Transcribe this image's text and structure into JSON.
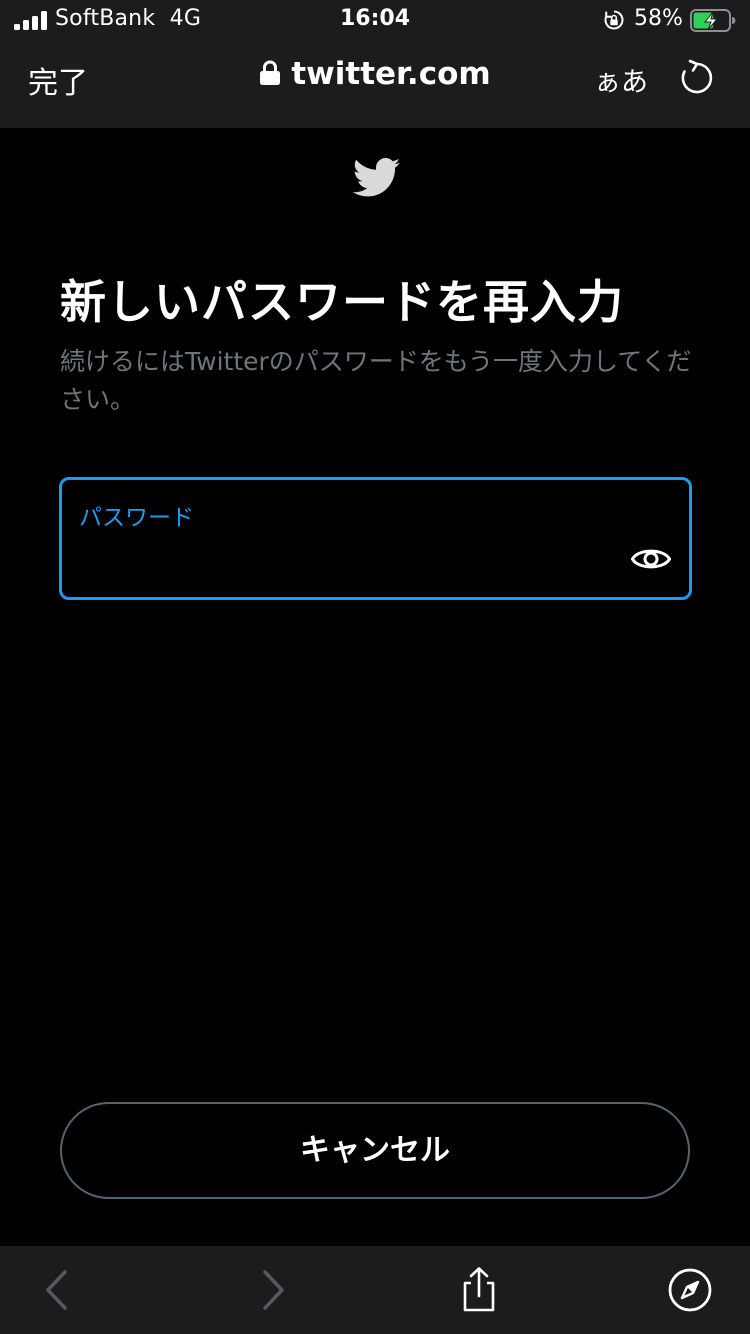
{
  "status_bar": {
    "carrier": "SoftBank",
    "network": "4G",
    "time": "16:04",
    "battery_percent": "58%",
    "battery_level": 0.58,
    "battery_color": "#30d158"
  },
  "browser": {
    "done_label": "完了",
    "url": "twitter.com",
    "text_size_label": "ぁあ",
    "icons": [
      "lock-icon",
      "reload-icon",
      "back-icon",
      "forward-icon",
      "share-icon",
      "compass-icon"
    ]
  },
  "page": {
    "logo_icon": "twitter-bird-icon",
    "title": "新しいパスワードを再入力",
    "subtitle": "続けるにはTwitterのパスワードをもう一度入力してください。",
    "password_field": {
      "label": "パスワード",
      "value": "",
      "toggle_icon": "eye-icon"
    },
    "cancel_label": "キャンセル"
  },
  "colors": {
    "accent": "#1d9bf0",
    "muted_text": "#6e767d",
    "chrome_bg": "#1c1c1e",
    "button_border": "#536471"
  }
}
